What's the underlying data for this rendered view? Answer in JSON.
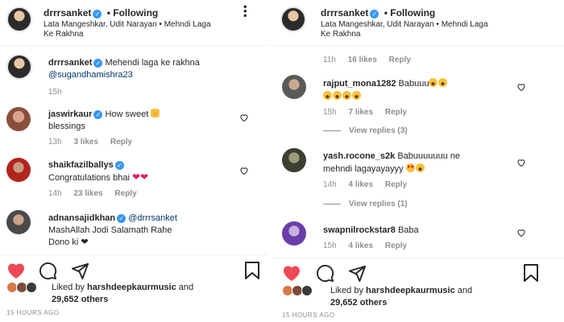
{
  "left": {
    "header": {
      "username": "drrrsanket",
      "following": "• Following",
      "audio": "Lata Mangeshkar, Udit Narayan • Mehndi Laga",
      "audio2": "Ke Rakhna",
      "more": "•••"
    },
    "caption": {
      "username": "drrrsanket",
      "text": "Mehendi laga ke rakhna",
      "mention": "@sugandhamishra23",
      "time": "15h"
    },
    "comments": [
      {
        "username": "jaswirkaur",
        "text": "How sweet",
        "text2": "blessings",
        "time": "13h",
        "likes": "3 likes",
        "reply": "Reply"
      },
      {
        "username": "shaikfazilballys",
        "text": "Congratulations bhai",
        "time": "14h",
        "likes": "23 likes",
        "reply": "Reply"
      },
      {
        "username": "adnansajidkhan",
        "mention": "@drrrsanket",
        "text": "MashAllah Jodi Salamath Rahe",
        "text2": "Dono ki ❤"
      }
    ],
    "likes": {
      "prefix": "Liked by",
      "user": "harshdeepkaurmusic",
      "and": "and",
      "count": "29,652 others"
    },
    "timestamp": "15 HOURS AGO"
  },
  "right": {
    "header": {
      "username": "drrrsanket",
      "following": "• Following",
      "audio": "Lata Mangeshkar, Udit Narayan • Mehndi Laga",
      "audio2": "Ke Rakhna",
      "more": "•••"
    },
    "top_meta": {
      "time": "11h",
      "likes": "16 likes",
      "reply": "Reply"
    },
    "comments": [
      {
        "username": "rajput_mona1282",
        "text": "Babuuu",
        "time": "15h",
        "likes": "7 likes",
        "reply": "Reply",
        "view_replies": "View replies (3)"
      },
      {
        "username": "yash.rocone_s2k",
        "text": "Babuuuuuuu ne",
        "text2": "mehndi lagayayayyy",
        "time": "14h",
        "likes": "4 likes",
        "reply": "Reply",
        "view_replies": "View replies (1)"
      },
      {
        "username": "swapnilrockstar8",
        "text": "Baba",
        "time": "15h",
        "likes": "4 likes",
        "reply": "Reply"
      }
    ],
    "likes": {
      "prefix": "Liked by",
      "user": "harshdeepkaurmusic",
      "and": "and",
      "count": "29,652 others"
    },
    "timestamp": "15 HOURS AGO"
  },
  "colors": {
    "like_red": "#ed4956",
    "verified_blue": "#3897f0",
    "muted": "#8e8e8e",
    "text": "#262626"
  },
  "icons": [
    "heart-filled-icon",
    "comment-icon",
    "share-icon",
    "bookmark-icon",
    "small-heart-icon",
    "verified-icon",
    "more-icon"
  ]
}
